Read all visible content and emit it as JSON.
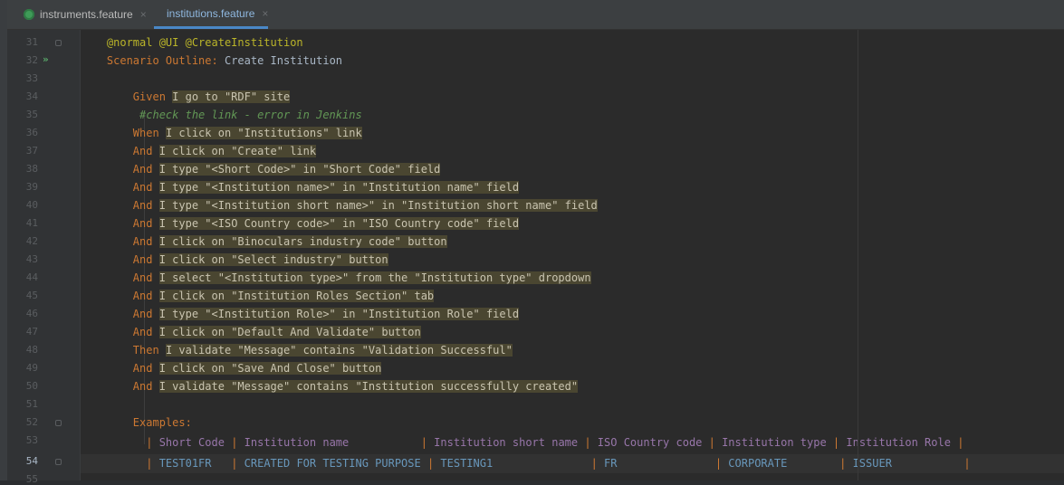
{
  "tabs": [
    {
      "label": "instruments.feature",
      "active": false
    },
    {
      "label": "institutions.feature",
      "active": true
    }
  ],
  "close_glyph": "×",
  "line_numbers": [
    "31",
    "32",
    "33",
    "34",
    "35",
    "36",
    "37",
    "38",
    "39",
    "40",
    "41",
    "42",
    "43",
    "44",
    "45",
    "46",
    "47",
    "48",
    "49",
    "50",
    "51",
    "52",
    "53",
    "54",
    "55"
  ],
  "run_glyph": "»",
  "tags": "@normal @UI @CreateInstitution",
  "scenario": {
    "keyword": "Scenario Outline:",
    "title": "Create Institution"
  },
  "steps": [
    {
      "kw": "Given",
      "text": "I go to \"RDF\" site"
    },
    {
      "comment": "#check the link - error in Jenkins"
    },
    {
      "kw": "When",
      "text": "I click on \"Institutions\" link"
    },
    {
      "kw": "And",
      "text": "I click on \"Create\" link"
    },
    {
      "kw": "And",
      "text": "I type \"<Short Code>\" in \"Short Code\" field"
    },
    {
      "kw": "And",
      "text": "I type \"<Institution name>\" in \"Institution name\" field"
    },
    {
      "kw": "And",
      "text": "I type \"<Institution short name>\" in \"Institution short name\" field"
    },
    {
      "kw": "And",
      "text": "I type \"<ISO Country code>\" in \"ISO Country code\" field"
    },
    {
      "kw": "And",
      "text": "I click on \"Binoculars industry code\" button"
    },
    {
      "kw": "And",
      "text": "I click on \"Select industry\" button"
    },
    {
      "kw": "And",
      "text": "I select \"<Institution type>\" from the \"Institution type\" dropdown"
    },
    {
      "kw": "And",
      "text": "I click on \"Institution Roles Section\" tab"
    },
    {
      "kw": "And",
      "text": "I type \"<Institution Role>\" in \"Institution Role\" field"
    },
    {
      "kw": "And",
      "text": "I click on \"Default And Validate\" button"
    },
    {
      "kw": "Then",
      "text": "I validate \"Message\" contains \"Validation Successful\""
    },
    {
      "kw": "And",
      "text": "I click on \"Save And Close\" button"
    },
    {
      "kw": "And",
      "text": "I validate \"Message\" contains \"Institution successfully created\""
    }
  ],
  "examples_keyword": "Examples:",
  "table": {
    "pipe": "|",
    "headers": [
      " Short Code ",
      " Institution name           ",
      " Institution short name ",
      " ISO Country code ",
      " Institution type ",
      " Institution Role "
    ],
    "row": [
      " TEST01FR   ",
      " CREATED FOR TESTING PURPOSE ",
      " TESTING1               ",
      " FR               ",
      " CORPORATE        ",
      " ISSUER           "
    ]
  },
  "colors": {
    "background": "#2b2b2b",
    "keyword": "#cc7832",
    "tag": "#bbb529",
    "step_highlight": "#4a4631",
    "comment": "#629755",
    "header": "#9876aa",
    "value": "#6897bb"
  }
}
